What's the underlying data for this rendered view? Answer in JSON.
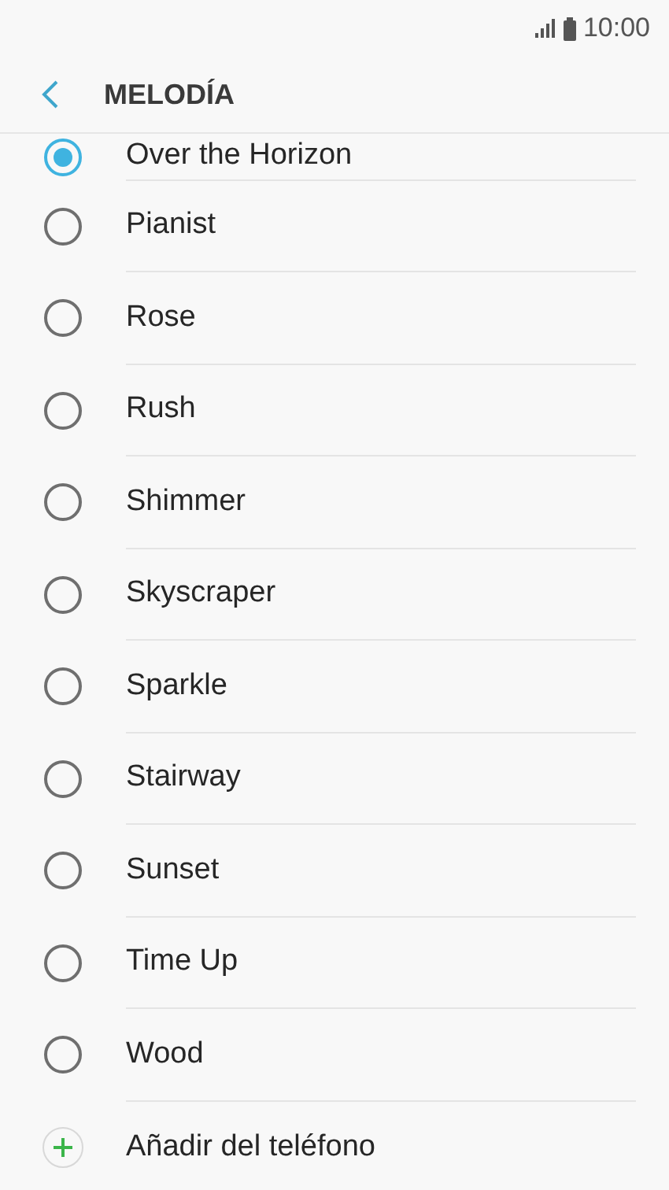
{
  "status_bar": {
    "time": "10:00"
  },
  "header": {
    "title": "MELODÍA"
  },
  "items": [
    {
      "kind": "radio",
      "label": "Over the Horizon",
      "selected": true
    },
    {
      "kind": "radio",
      "label": "Pianist",
      "selected": false
    },
    {
      "kind": "radio",
      "label": "Rose",
      "selected": false
    },
    {
      "kind": "radio",
      "label": "Rush",
      "selected": false
    },
    {
      "kind": "radio",
      "label": "Shimmer",
      "selected": false
    },
    {
      "kind": "radio",
      "label": "Skyscraper",
      "selected": false
    },
    {
      "kind": "radio",
      "label": "Sparkle",
      "selected": false
    },
    {
      "kind": "radio",
      "label": "Stairway",
      "selected": false
    },
    {
      "kind": "radio",
      "label": "Sunset",
      "selected": false
    },
    {
      "kind": "radio",
      "label": "Time Up",
      "selected": false
    },
    {
      "kind": "radio",
      "label": "Wood",
      "selected": false
    },
    {
      "kind": "add",
      "label": "Añadir del teléfono"
    }
  ]
}
